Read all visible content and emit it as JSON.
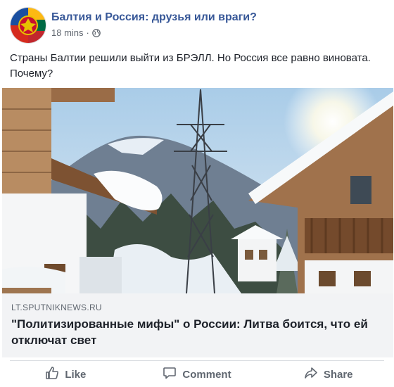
{
  "post": {
    "page_name": "Балтия и Россия: друзья или враги?",
    "time": "18 mins",
    "separator": "·",
    "privacy_icon": "globe-icon",
    "text": "Страны Балтии решили выйти из БРЭЛЛ. Но Россия все равно виновата. Почему?"
  },
  "link": {
    "domain": "LT.SPUTNIKNEWS.RU",
    "headline": "\"Политизированные мифы\" о России: Литва боится, что ей отключат свет"
  },
  "actions": {
    "like_label": "Like",
    "comment_label": "Comment",
    "share_label": "Share"
  },
  "colors": {
    "page_name": "#385898",
    "meta": "#616770",
    "link_bg": "#f2f3f5",
    "action": "#606770"
  }
}
